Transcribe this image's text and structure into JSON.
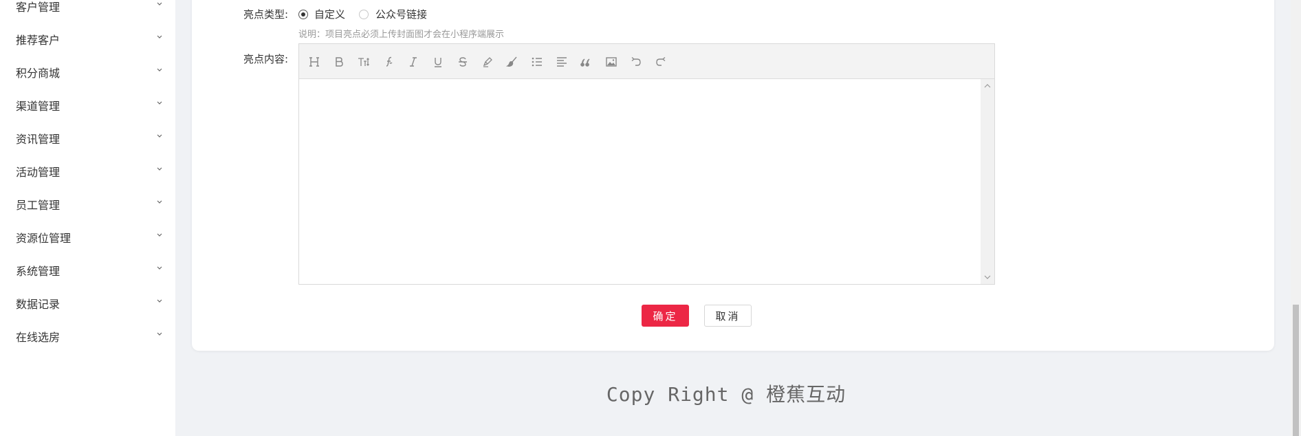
{
  "sidebar": {
    "items": [
      {
        "label": "客户管理"
      },
      {
        "label": "推荐客户"
      },
      {
        "label": "积分商城"
      },
      {
        "label": "渠道管理"
      },
      {
        "label": "资讯管理"
      },
      {
        "label": "活动管理"
      },
      {
        "label": "员工管理"
      },
      {
        "label": "资源位管理"
      },
      {
        "label": "系统管理"
      },
      {
        "label": "数据记录"
      },
      {
        "label": "在线选房"
      }
    ],
    "chevron_icon": "chevron-down-icon"
  },
  "form": {
    "highlight_type_label": "亮点类型:",
    "options": [
      {
        "label": "自定义",
        "checked": true
      },
      {
        "label": "公众号链接",
        "checked": false
      }
    ],
    "hint": "说明：项目亮点必须上传封面图才会在小程序端展示",
    "content_label": "亮点内容:",
    "toolbar_icons": [
      "heading-icon",
      "bold-icon",
      "font-size-icon",
      "font-family-icon",
      "italic-icon",
      "underline-icon",
      "strikethrough-icon",
      "highlight-pen-icon",
      "brush-icon",
      "list-icon",
      "align-icon",
      "quote-icon",
      "image-icon",
      "undo-icon",
      "redo-icon"
    ],
    "editor_value": ""
  },
  "actions": {
    "ok_label": "确定",
    "cancel_label": "取消",
    "ok_color": "#ec2745"
  },
  "footer": {
    "text": "Copy Right @ 橙蕉互动"
  }
}
